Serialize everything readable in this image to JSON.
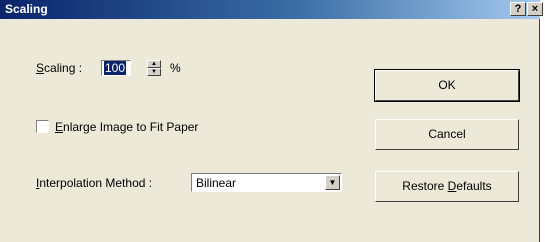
{
  "window": {
    "title": "Scaling",
    "help_label": "?",
    "close_label": "×"
  },
  "scaling": {
    "label_accel": "S",
    "label_rest": "caling :",
    "value": "100",
    "unit": "%",
    "up_arrow": "▲",
    "down_arrow": "▼"
  },
  "enlarge": {
    "label_accel": "E",
    "label_rest": "nlarge Image to Fit Paper",
    "checked": false
  },
  "interpolation": {
    "label_accel": "I",
    "label_rest": "nterpolation Method :",
    "selected": "Bilinear",
    "dropdown_arrow": "▼"
  },
  "buttons": {
    "ok": "OK",
    "cancel": "Cancel",
    "restore_prefix": "Restore ",
    "restore_accel": "D",
    "restore_suffix": "efaults"
  }
}
